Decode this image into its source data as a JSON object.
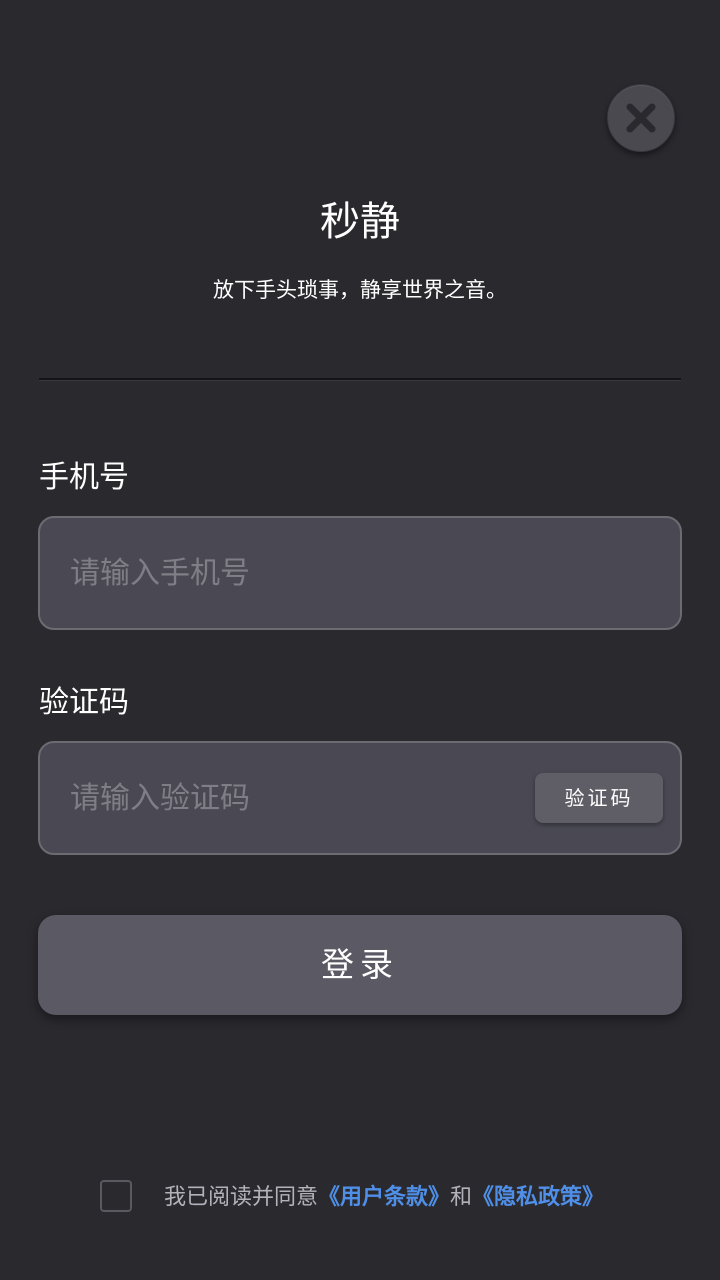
{
  "colors": {
    "background": "#2a292e",
    "field_background": "#4a4953",
    "button_background": "#5b5a64",
    "link": "#4f8fe8"
  },
  "header": {
    "close_icon": "close-icon",
    "title": "秒静",
    "subtitle": "放下手头琐事，静享世界之音。"
  },
  "form": {
    "phone": {
      "label": "手机号",
      "placeholder": "请输入手机号",
      "value": ""
    },
    "code": {
      "label": "验证码",
      "placeholder": "请输入验证码",
      "value": "",
      "button_label": "验证码"
    },
    "login_label": "登录"
  },
  "agreement": {
    "checked": false,
    "prefix": "我已阅读并同意",
    "terms_link": "《用户条款》",
    "conjunction": "和",
    "privacy_link": "《隐私政策》"
  }
}
